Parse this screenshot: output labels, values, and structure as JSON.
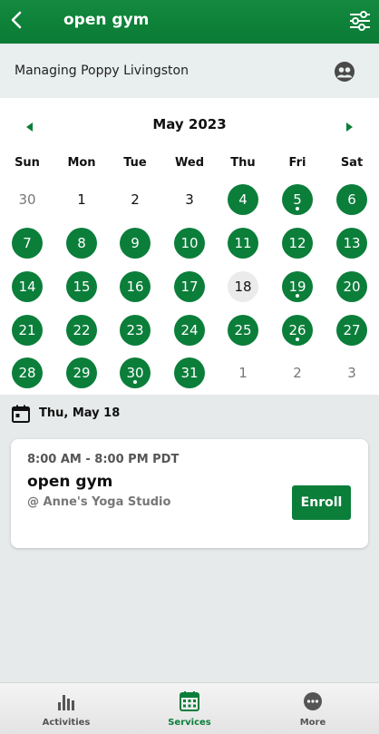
{
  "header": {
    "title": "open gym",
    "back_icon": "chevron-left-icon",
    "filter_icon": "sliders-icon"
  },
  "managing": {
    "text": "Managing Poppy Livingston",
    "icon": "people-icon"
  },
  "calendar": {
    "month_label": "May 2023",
    "weekdays": [
      "Sun",
      "Mon",
      "Tue",
      "Wed",
      "Thu",
      "Fri",
      "Sat"
    ],
    "weeks": [
      [
        {
          "d": "30",
          "s": "muted"
        },
        {
          "d": "1",
          "s": "plain"
        },
        {
          "d": "2",
          "s": "plain"
        },
        {
          "d": "3",
          "s": "plain"
        },
        {
          "d": "4",
          "s": "avail"
        },
        {
          "d": "5",
          "s": "avail",
          "dot": true
        },
        {
          "d": "6",
          "s": "avail"
        }
      ],
      [
        {
          "d": "7",
          "s": "avail"
        },
        {
          "d": "8",
          "s": "avail"
        },
        {
          "d": "9",
          "s": "avail"
        },
        {
          "d": "10",
          "s": "avail"
        },
        {
          "d": "11",
          "s": "avail"
        },
        {
          "d": "12",
          "s": "avail"
        },
        {
          "d": "13",
          "s": "avail"
        }
      ],
      [
        {
          "d": "14",
          "s": "avail"
        },
        {
          "d": "15",
          "s": "avail"
        },
        {
          "d": "16",
          "s": "avail"
        },
        {
          "d": "17",
          "s": "avail"
        },
        {
          "d": "18",
          "s": "today"
        },
        {
          "d": "19",
          "s": "avail",
          "dot": true
        },
        {
          "d": "20",
          "s": "avail"
        }
      ],
      [
        {
          "d": "21",
          "s": "avail"
        },
        {
          "d": "22",
          "s": "avail"
        },
        {
          "d": "23",
          "s": "avail"
        },
        {
          "d": "24",
          "s": "avail"
        },
        {
          "d": "25",
          "s": "avail"
        },
        {
          "d": "26",
          "s": "avail",
          "dot": true
        },
        {
          "d": "27",
          "s": "avail"
        }
      ],
      [
        {
          "d": "28",
          "s": "avail"
        },
        {
          "d": "29",
          "s": "avail"
        },
        {
          "d": "30",
          "s": "avail",
          "dot": true
        },
        {
          "d": "31",
          "s": "avail"
        },
        {
          "d": "1",
          "s": "muted"
        },
        {
          "d": "2",
          "s": "muted"
        },
        {
          "d": "3",
          "s": "muted"
        }
      ]
    ]
  },
  "selected": {
    "date_label": "Thu, May 18"
  },
  "session": {
    "time": "8:00 AM - 8:00 PM PDT",
    "name": "open gym",
    "location": "@ Anne's Yoga Studio",
    "enroll_label": "Enroll"
  },
  "bottom_nav": {
    "tabs": [
      {
        "label": "Activities",
        "icon": "bar-chart-icon",
        "active": false
      },
      {
        "label": "Services",
        "icon": "calendar-grid-icon",
        "active": true
      },
      {
        "label": "More",
        "icon": "more-dots-icon",
        "active": false
      }
    ]
  },
  "colors": {
    "brand_green": "#0b7e3a",
    "background": "#e6eaea"
  }
}
